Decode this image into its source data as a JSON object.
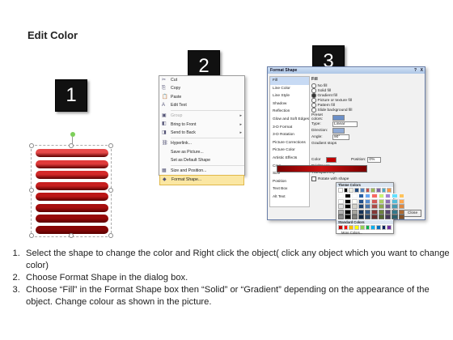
{
  "title": "Edit Color",
  "steps": [
    "1",
    "2",
    "3"
  ],
  "shape": {
    "bar_colors": [
      "#e84b4b",
      "#e03a3a",
      "#d42a2a",
      "#c81f1f",
      "#bc1616",
      "#a80f0f",
      "#970a0a",
      "#860606"
    ]
  },
  "context_menu": {
    "items": [
      {
        "label": "Cut",
        "icon": "✂",
        "disabled": false,
        "submenu": false
      },
      {
        "label": "Copy",
        "icon": "⎘",
        "disabled": false,
        "submenu": false
      },
      {
        "label": "Paste",
        "icon": "📋",
        "disabled": false,
        "submenu": false
      },
      {
        "label": "Edit Text",
        "icon": "A",
        "disabled": false,
        "submenu": false
      },
      {
        "label": "Group",
        "icon": "▣",
        "disabled": true,
        "submenu": true
      },
      {
        "label": "Bring to Front",
        "icon": "◧",
        "disabled": false,
        "submenu": true
      },
      {
        "label": "Send to Back",
        "icon": "◨",
        "disabled": false,
        "submenu": true
      },
      {
        "label": "Hyperlink...",
        "icon": "⛓",
        "disabled": false,
        "submenu": false
      },
      {
        "label": "Save as Picture...",
        "icon": "",
        "disabled": false,
        "submenu": false
      },
      {
        "label": "Set as Default Shape",
        "icon": "",
        "disabled": false,
        "submenu": false
      },
      {
        "label": "Size and Position...",
        "icon": "▦",
        "disabled": false,
        "submenu": false
      },
      {
        "label": "Format Shape...",
        "icon": "◆",
        "disabled": false,
        "submenu": false,
        "highlight": true
      }
    ]
  },
  "dialog": {
    "title": "Format Shape",
    "help": "?",
    "close_x": "X",
    "nav": [
      "Fill",
      "Line Color",
      "Line Style",
      "Shadow",
      "Reflection",
      "Glow and Soft Edges",
      "3-D Format",
      "3-D Rotation",
      "Picture Corrections",
      "Picture Color",
      "Artistic Effects",
      "Crop",
      "Size",
      "Position",
      "Text Box",
      "Alt Text"
    ],
    "active_nav": "Fill",
    "section": "Fill",
    "fill_options": [
      "No fill",
      "Solid fill",
      "Gradient fill",
      "Picture or texture fill",
      "Pattern fill",
      "Slide background fill"
    ],
    "selected_fill": "Gradient fill",
    "preset_label": "Preset colors:",
    "type_label": "Type:",
    "type_value": "Linear",
    "direction_label": "Direction:",
    "angle_label": "Angle:",
    "angle_value": "90°",
    "stops_label": "Gradient stops",
    "color_label": "Color",
    "position_label": "Position:",
    "position_value": "0%",
    "brightness_label": "Brightness",
    "transparency_label": "Transparency",
    "rotate_label": "Rotate with shape",
    "close_button": "Close"
  },
  "palette": {
    "theme_header": "Theme Colors",
    "standard_header": "Standard Colors",
    "more_colors": "More Colors...",
    "theme_top": [
      "#ffffff",
      "#000000",
      "#eeece1",
      "#1f497d",
      "#4f81bd",
      "#c0504d",
      "#9bbb59",
      "#8064a2",
      "#4bacc6",
      "#f79646"
    ],
    "standard": [
      "#c00000",
      "#ff0000",
      "#ffc000",
      "#ffff00",
      "#92d050",
      "#00b050",
      "#00b0f0",
      "#0070c0",
      "#002060",
      "#7030a0"
    ]
  },
  "instructions": [
    "Select the shape to change the color and Right click the object( click any object which you want to change color)",
    "Choose Format Shape in the dialog box.",
    "Choose “Fill” in the Format Shape box then “Solid” or “Gradient” depending on the appearance of the object. Change colour as shown in the picture."
  ]
}
